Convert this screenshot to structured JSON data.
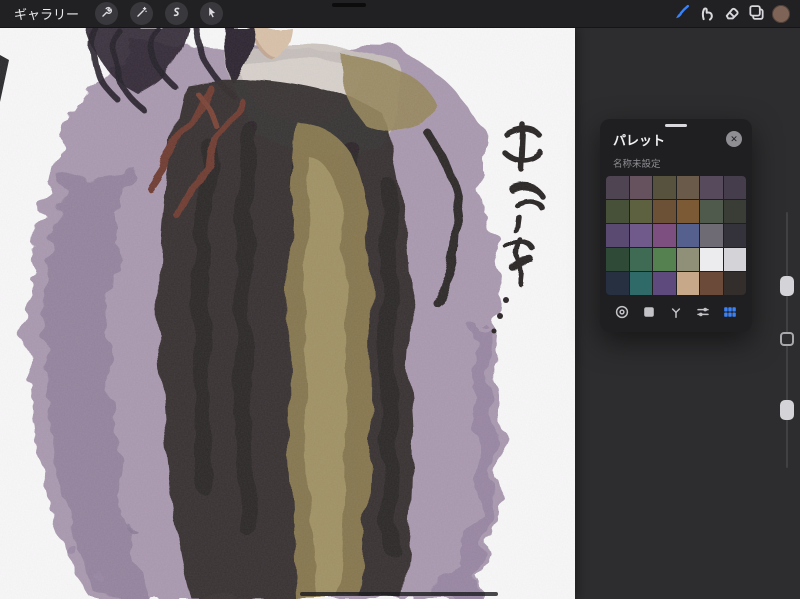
{
  "accent_color": "#3b82f7",
  "topbar": {
    "gallery_label": "ギャラリー",
    "tools_left": [
      "actions",
      "adjustments",
      "selection",
      "transform"
    ],
    "tools_right": [
      "paint",
      "smudge",
      "erase",
      "layers",
      "color"
    ],
    "selected_tool": "paint",
    "current_color": "#7d6457"
  },
  "palette_panel": {
    "title": "パレット",
    "name": "名称未設定",
    "close_glyph": "✕",
    "modes": [
      "disc",
      "classic",
      "harmony",
      "value",
      "palettes"
    ],
    "selected_mode": "palettes",
    "swatches": [
      [
        "#4f4452",
        "#66525f",
        "#56523d",
        "#6a5a49",
        "#564a5c",
        "#453d4b"
      ],
      [
        "#47513a",
        "#5d6140",
        "#6d5136",
        "#7c5a36",
        "#4f5a4c",
        "#3a3d35"
      ],
      [
        "#5a4a72",
        "#705a8c",
        "#7c4f80",
        "#55608f",
        "#6e6b74",
        "#34323a"
      ],
      [
        "#2f4a36",
        "#3f6b54",
        "#55804f",
        "#8f9077",
        "#ececee",
        "#d4d4d8"
      ],
      [
        "#263040",
        "#2f6968",
        "#5e4a7c",
        "#c7a98a",
        "#6b4a3a",
        "#332e2c"
      ]
    ]
  }
}
